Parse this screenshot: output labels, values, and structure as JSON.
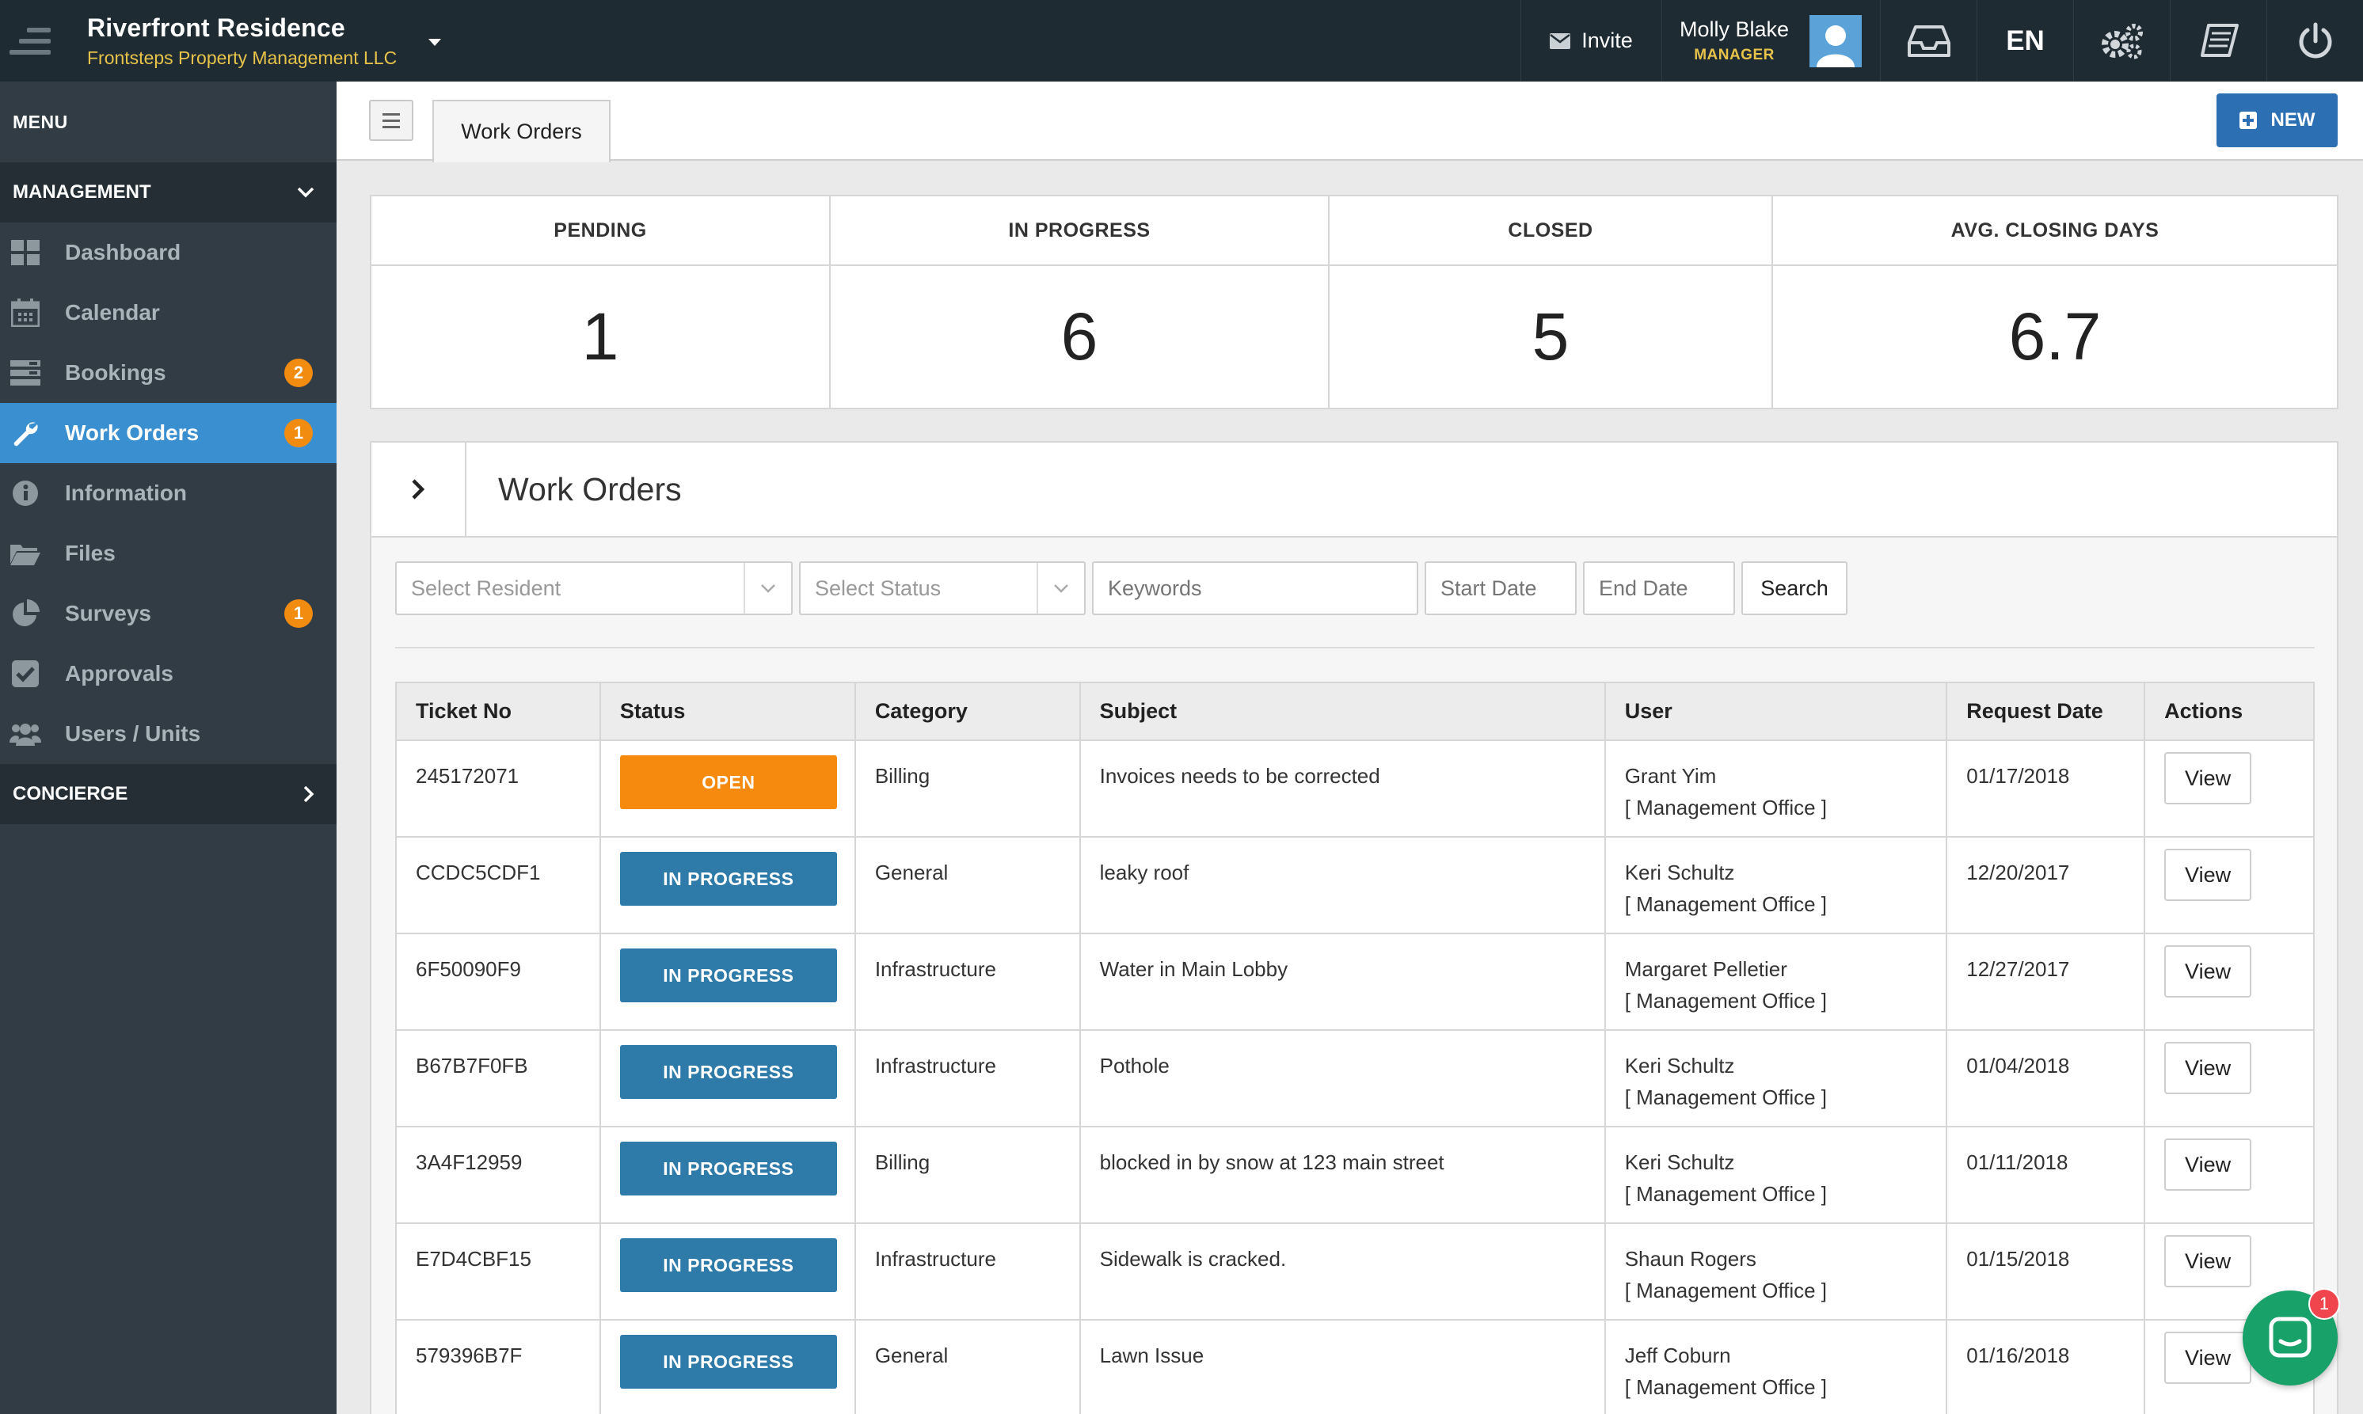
{
  "header": {
    "title": "Riverfront Residence",
    "subtitle": "Frontsteps Property Management LLC",
    "invite_label": "Invite",
    "user_name": "Molly Blake",
    "user_role": "MANAGER",
    "language": "EN"
  },
  "sidebar": {
    "menu_label": "MENU",
    "section_management": "MANAGEMENT",
    "section_concierge": "CONCIERGE",
    "items": [
      {
        "label": "Dashboard",
        "icon": "dashboard-icon",
        "badge": ""
      },
      {
        "label": "Calendar",
        "icon": "calendar-icon",
        "badge": ""
      },
      {
        "label": "Bookings",
        "icon": "bookings-icon",
        "badge": "2"
      },
      {
        "label": "Work Orders",
        "icon": "wrench-icon",
        "badge": "1"
      },
      {
        "label": "Information",
        "icon": "info-icon",
        "badge": ""
      },
      {
        "label": "Files",
        "icon": "folder-icon",
        "badge": ""
      },
      {
        "label": "Surveys",
        "icon": "pie-chart-icon",
        "badge": "1"
      },
      {
        "label": "Approvals",
        "icon": "checkbox-icon",
        "badge": ""
      },
      {
        "label": "Users / Units",
        "icon": "users-icon",
        "badge": ""
      }
    ]
  },
  "tabbar": {
    "tab_label": "Work Orders",
    "new_label": "NEW"
  },
  "stats": {
    "pending_label": "PENDING",
    "pending_value": "1",
    "in_progress_label": "IN PROGRESS",
    "in_progress_value": "6",
    "closed_label": "CLOSED",
    "closed_value": "5",
    "avg_label": "AVG. CLOSING DAYS",
    "avg_value": "6.7"
  },
  "panel": {
    "title": "Work Orders",
    "filters": {
      "resident_placeholder": "Select Resident",
      "status_placeholder": "Select Status",
      "keywords_placeholder": "Keywords",
      "start_placeholder": "Start Date",
      "end_placeholder": "End Date",
      "search_label": "Search"
    }
  },
  "table": {
    "headers": [
      "Ticket No",
      "Status",
      "Category",
      "Subject",
      "User",
      "Request Date",
      "Actions"
    ],
    "view_label": "View",
    "rows": [
      {
        "ticket": "245172071",
        "status": "OPEN",
        "category": "Billing",
        "subject": "Invoices needs to be corrected",
        "user": "Grant Yim",
        "office": "[ Management Office ]",
        "date": "01/17/2018"
      },
      {
        "ticket": "CCDC5CDF1",
        "status": "IN PROGRESS",
        "category": "General",
        "subject": "leaky roof",
        "user": "Keri Schultz",
        "office": "[ Management Office ]",
        "date": "12/20/2017"
      },
      {
        "ticket": "6F50090F9",
        "status": "IN PROGRESS",
        "category": "Infrastructure",
        "subject": "Water in Main Lobby",
        "user": "Margaret Pelletier",
        "office": "[ Management Office ]",
        "date": "12/27/2017"
      },
      {
        "ticket": "B67B7F0FB",
        "status": "IN PROGRESS",
        "category": "Infrastructure",
        "subject": "Pothole",
        "user": "Keri Schultz",
        "office": "[ Management Office ]",
        "date": "01/04/2018"
      },
      {
        "ticket": "3A4F12959",
        "status": "IN PROGRESS",
        "category": "Billing",
        "subject": "blocked in by snow at 123 main street",
        "user": "Keri Schultz",
        "office": "[ Management Office ]",
        "date": "01/11/2018"
      },
      {
        "ticket": "E7D4CBF15",
        "status": "IN PROGRESS",
        "category": "Infrastructure",
        "subject": "Sidewalk is cracked.",
        "user": "Shaun Rogers",
        "office": "[ Management Office ]",
        "date": "01/15/2018"
      },
      {
        "ticket": "579396B7F",
        "status": "IN PROGRESS",
        "category": "General",
        "subject": "Lawn Issue",
        "user": "Jeff Coburn",
        "office": "[ Management Office ]",
        "date": "01/16/2018"
      }
    ]
  },
  "chat": {
    "badge": "1"
  },
  "colors": {
    "topbar": "#1e2b33",
    "sidebar": "#323c44",
    "active": "#3a8fd1",
    "badge": "#f28c11",
    "status_open": "#f58a0f",
    "status_progress": "#2e7aa8",
    "primary_button": "#2c6fb3",
    "chat": "#18a168"
  }
}
